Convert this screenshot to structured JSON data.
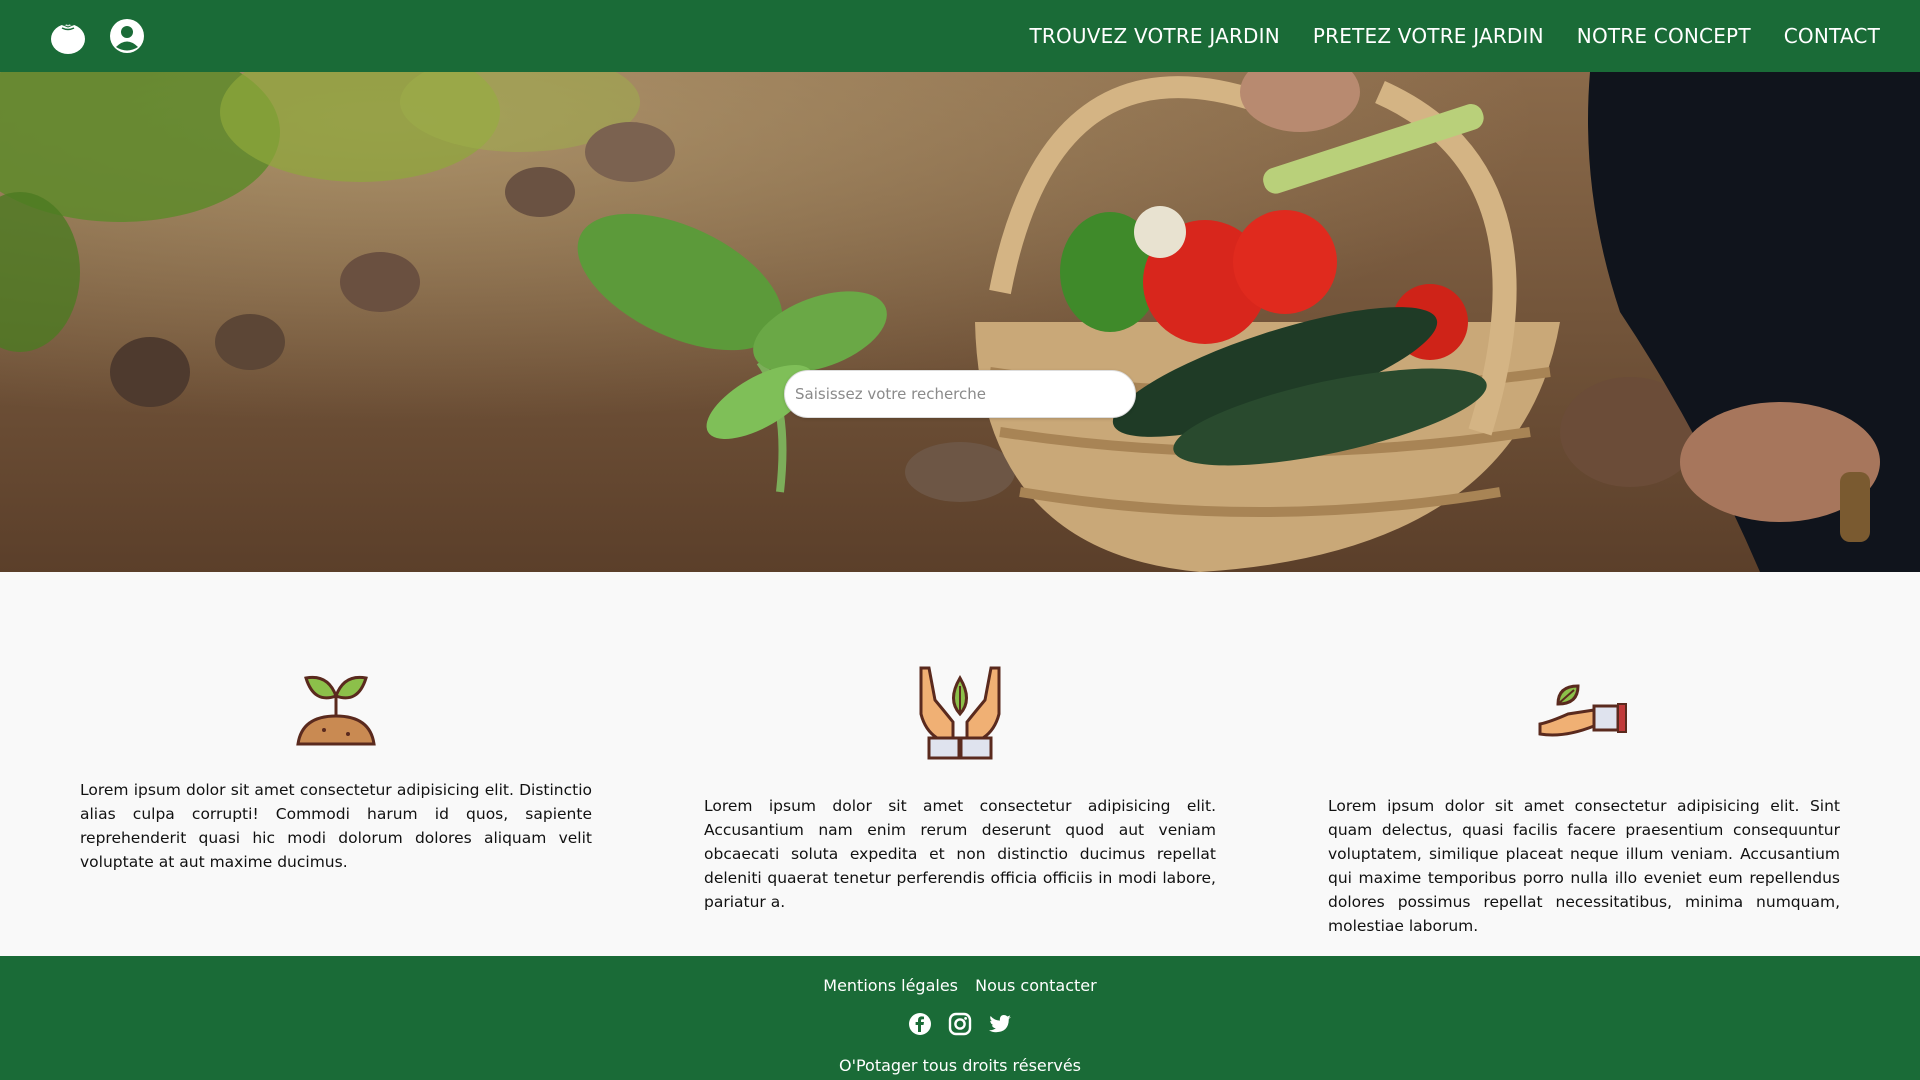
{
  "header": {
    "logo_icon": "tomato-icon",
    "account_icon": "user-circle-icon",
    "nav": [
      {
        "label": "TROUVEZ VOTRE JARDIN"
      },
      {
        "label": "PRETEZ VOTRE JARDIN"
      },
      {
        "label": "NOTRE CONCEPT"
      },
      {
        "label": "CONTACT"
      }
    ]
  },
  "hero": {
    "image": "vegetable-basket-garden-photo",
    "search_placeholder": "Saisissez votre recherche"
  },
  "features": [
    {
      "icon": "sprout-icon",
      "text": "Lorem ipsum dolor sit amet consectetur adipisicing elit. Distinctio alias culpa corrupti! Commodi harum id quos, sapiente reprehenderit quasi hic modi dolorum dolores aliquam velit voluptate at aut maxime ducimus."
    },
    {
      "icon": "hands-leaf-icon",
      "text": "Lorem ipsum dolor sit amet consectetur adipisicing elit. Accusantium nam enim rerum deserunt quod aut veniam obcaecati soluta expedita et non distinctio ducimus repellat deleniti quaerat tenetur perferendis officia officiis in modi labore, pariatur a."
    },
    {
      "icon": "hand-leaf-icon",
      "text": "Lorem ipsum dolor sit amet consectetur adipisicing elit. Sint quam delectus, quasi facilis facere praesentium consequuntur voluptatem, similique placeat neque illum veniam. Accusantium qui maxime temporibus porro nulla illo eveniet eum repellendus dolores possimus repellat necessitatibus, minima numquam, molestiae laborum."
    }
  ],
  "footer": {
    "links": [
      {
        "label": "Mentions légales"
      },
      {
        "label": "Nous contacter"
      }
    ],
    "social": [
      "facebook-icon",
      "instagram-icon",
      "twitter-icon"
    ],
    "copyright": "O'Potager tous droits réservés"
  },
  "colors": {
    "brand_green": "#1a6b37",
    "background": "#f9f9f9"
  }
}
